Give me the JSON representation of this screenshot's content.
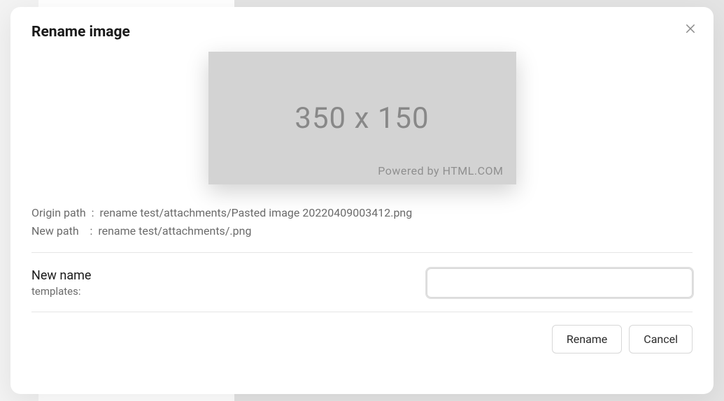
{
  "modal": {
    "title": "Rename image"
  },
  "preview": {
    "dimensions": "350 x 150",
    "caption": "Powered by HTML.COM"
  },
  "paths": {
    "origin_label": "Origin path  :  ",
    "origin_value": "rename test/attachments/Pasted image 20220409003412.png",
    "new_label": "New path    :  ",
    "new_value": "rename test/attachments/.png"
  },
  "form": {
    "label": "New name",
    "sub": "templates:",
    "value": "",
    "placeholder": ""
  },
  "buttons": {
    "rename": "Rename",
    "cancel": "Cancel"
  }
}
